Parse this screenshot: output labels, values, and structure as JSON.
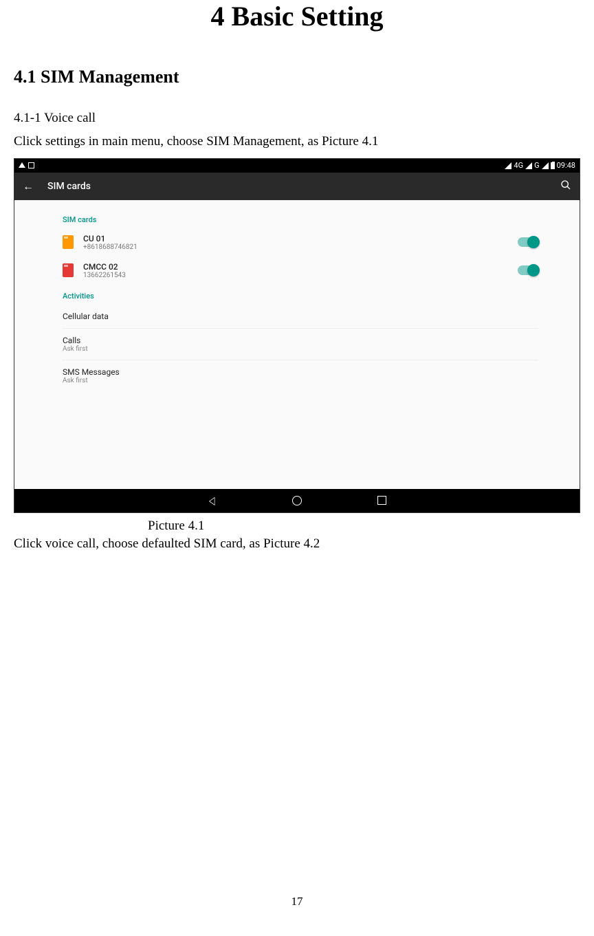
{
  "doc": {
    "chapter_title": "4 Basic Setting",
    "section_title": "4.1 SIM Management",
    "subsection": "4.1-1 Voice call",
    "intro_text": "Click settings in main menu, choose SIM Management, as Picture 4.1",
    "caption": "Picture 4.1",
    "post_caption": "Click voice call, choose defaulted SIM card, as Picture 4.2",
    "page_number": "17"
  },
  "status": {
    "net1": "4G",
    "net2": "G",
    "time": "09:48"
  },
  "appbar": {
    "title": "SIM cards"
  },
  "content": {
    "sim_label": "SIM cards",
    "sim1_name": "CU 01",
    "sim1_number": "+8618688746821",
    "sim2_name": "CMCC 02",
    "sim2_number": "13662261543",
    "activities_label": "Activities",
    "cellular": "Cellular data",
    "calls_title": "Calls",
    "calls_sub": "Ask first",
    "sms_title": "SMS Messages",
    "sms_sub": "Ask first"
  }
}
